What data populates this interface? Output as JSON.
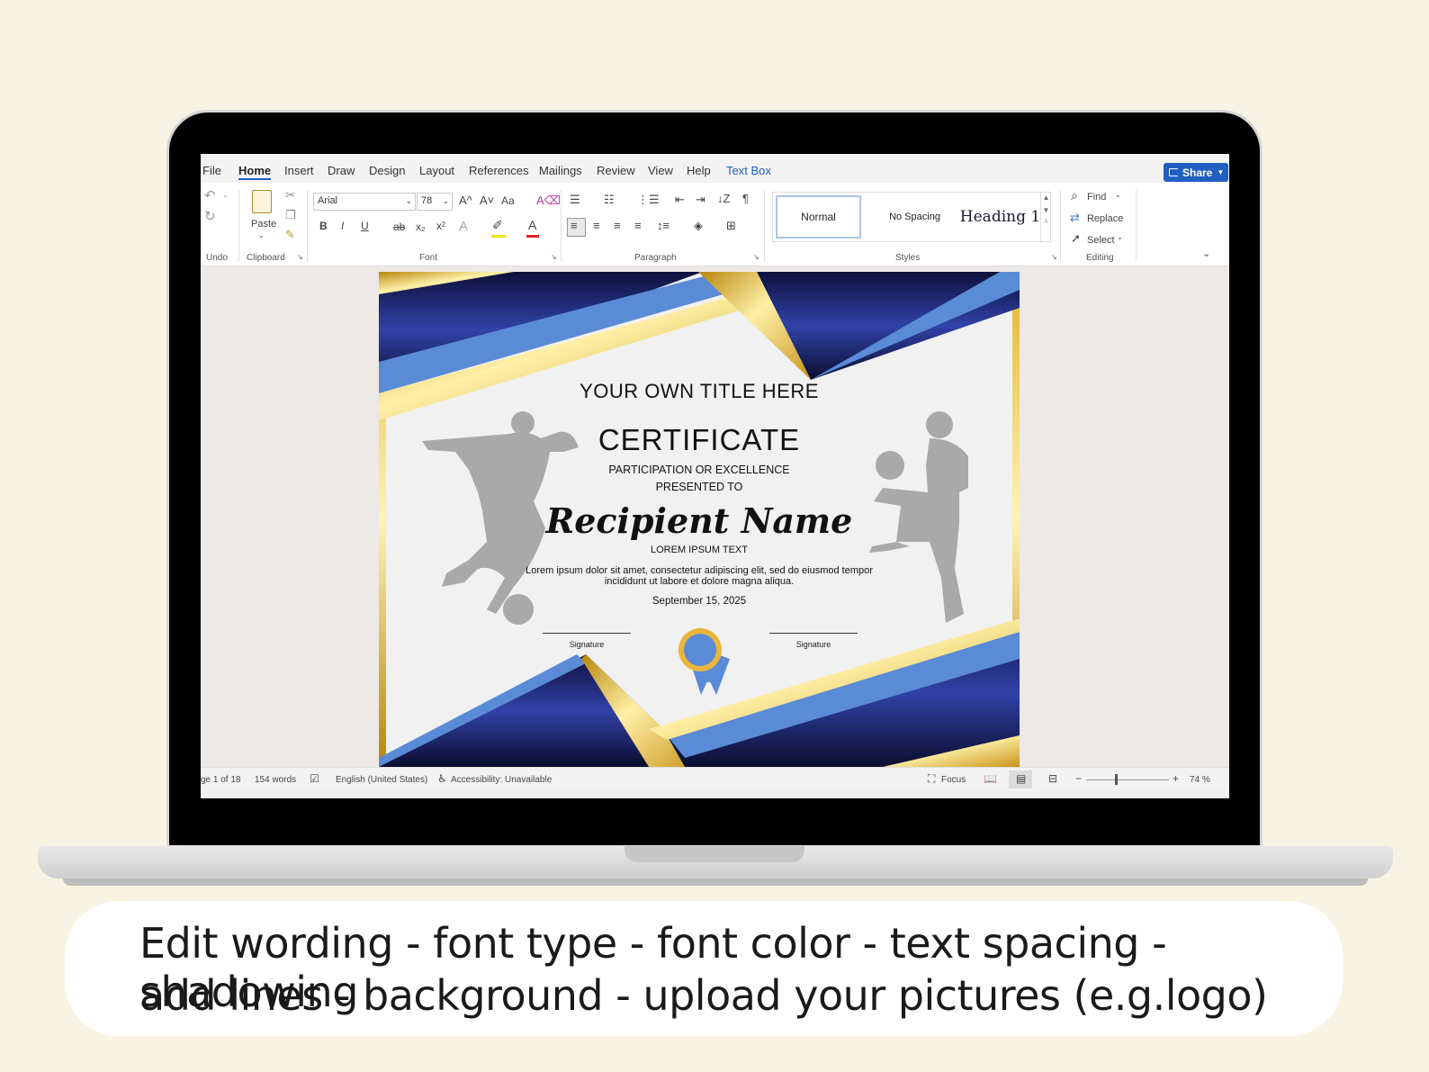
{
  "menu": {
    "tabs": [
      "File",
      "Home",
      "Insert",
      "Draw",
      "Design",
      "Layout",
      "References",
      "Mailings",
      "Review",
      "View",
      "Help",
      "Text Box"
    ],
    "active_tab": "Home",
    "share_label": "Share"
  },
  "ribbon": {
    "undo_label": "Undo",
    "paste_label": "Paste",
    "clipboard_label": "Clipboard",
    "font_name": "Arial",
    "font_size": "78",
    "font_label": "Font",
    "paragraph_label": "Paragraph",
    "styles": [
      "Normal",
      "No Spacing",
      "Heading 1"
    ],
    "styles_label": "Styles",
    "find_label": "Find",
    "replace_label": "Replace",
    "select_label": "Select",
    "editing_label": "Editing",
    "bold_glyph": "B",
    "italic_glyph": "I",
    "underline_glyph": "U",
    "strike_glyph": "ab",
    "grow_glyph": "A^",
    "shrink_glyph": "A˅",
    "case_glyph": "Aa",
    "pilcrow_glyph": "¶"
  },
  "certificate": {
    "title": "YOUR OWN TITLE HERE",
    "heading": "CERTIFICATE",
    "sub1": "PARTICIPATION OR EXCELLENCE",
    "sub2": "PRESENTED TO",
    "recipient": "Recipient Name",
    "lorem_label": "LOREM IPSUM TEXT",
    "body": "Lorem ipsum dolor sit amet, consectetur adipiscing elit, sed do eiusmod tempor incididunt ut labore et dolore magna aliqua.",
    "date": "September 15, 2025",
    "signature_left": "Signature",
    "signature_right": "Signature",
    "colors": {
      "gold": "#d4a81a",
      "blue": "#5a8bd6",
      "navy": "#1b1f5e"
    }
  },
  "status": {
    "page": "ge 1 of 18",
    "words": "154 words",
    "language": "English (United States)",
    "accessibility": "Accessibility: Unavailable",
    "focus": "Focus",
    "zoom_minus": "−",
    "zoom_plus": "+",
    "zoom": "74 %"
  },
  "caption": {
    "line1": "Edit wording - font type - font color - text spacing - shadowing",
    "line2": "add lines - background -  upload your pictures (e.g.logo)"
  }
}
